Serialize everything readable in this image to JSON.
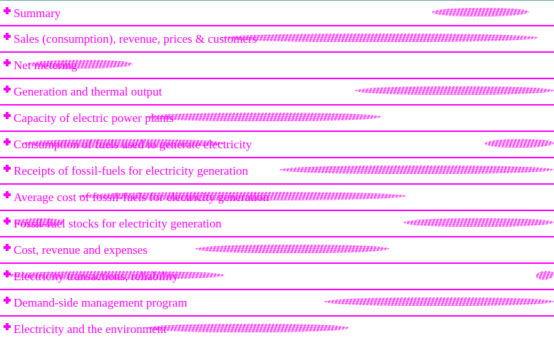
{
  "accent_color": "#ff00ff",
  "expand_icon": "plus-icon",
  "sections": [
    {
      "label": "Summary"
    },
    {
      "label": "Sales (consumption), revenue, prices & customers"
    },
    {
      "label": "Net metering"
    },
    {
      "label": "Generation and thermal output"
    },
    {
      "label": "Capacity of electric power plants"
    },
    {
      "label": "Consumption of fuels used to generate electricity"
    },
    {
      "label": "Receipts of fossil-fuels for electricity generation"
    },
    {
      "label": "Average cost of fossil-fuels for electricity generation"
    },
    {
      "label": "Fossil-fuel stocks for electricity generation"
    },
    {
      "label": "Cost, revenue and expenses"
    },
    {
      "label": "Electricity transactions, reliability"
    },
    {
      "label": "Demand-side management program"
    },
    {
      "label": "Electricity and the environment"
    }
  ]
}
